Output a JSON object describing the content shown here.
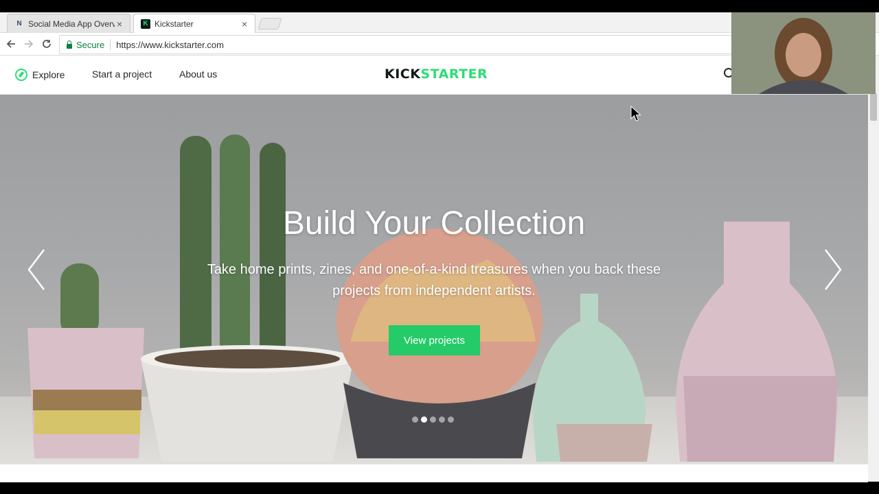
{
  "tabs": [
    {
      "title": "Social Media App Overv",
      "close": "×"
    },
    {
      "title": "Kickstarter",
      "close": "×"
    }
  ],
  "omnibox": {
    "security": "Secure",
    "url": "https://www.kickstarter.com"
  },
  "site": {
    "nav": {
      "explore": "Explore",
      "start": "Start a project",
      "about": "About us"
    },
    "logo_part1": "KICK",
    "logo_part2": "STARTER"
  },
  "hero": {
    "title": "Build Your Collection",
    "subtitle": "Take home prints, zines, and one-of-a-kind treasures when you back these projects from independent artists.",
    "cta": "View projects",
    "slide_count": 5,
    "active_slide": 2
  },
  "colors": {
    "brand_green": "#2bde73",
    "cta_green": "#25cb68"
  }
}
